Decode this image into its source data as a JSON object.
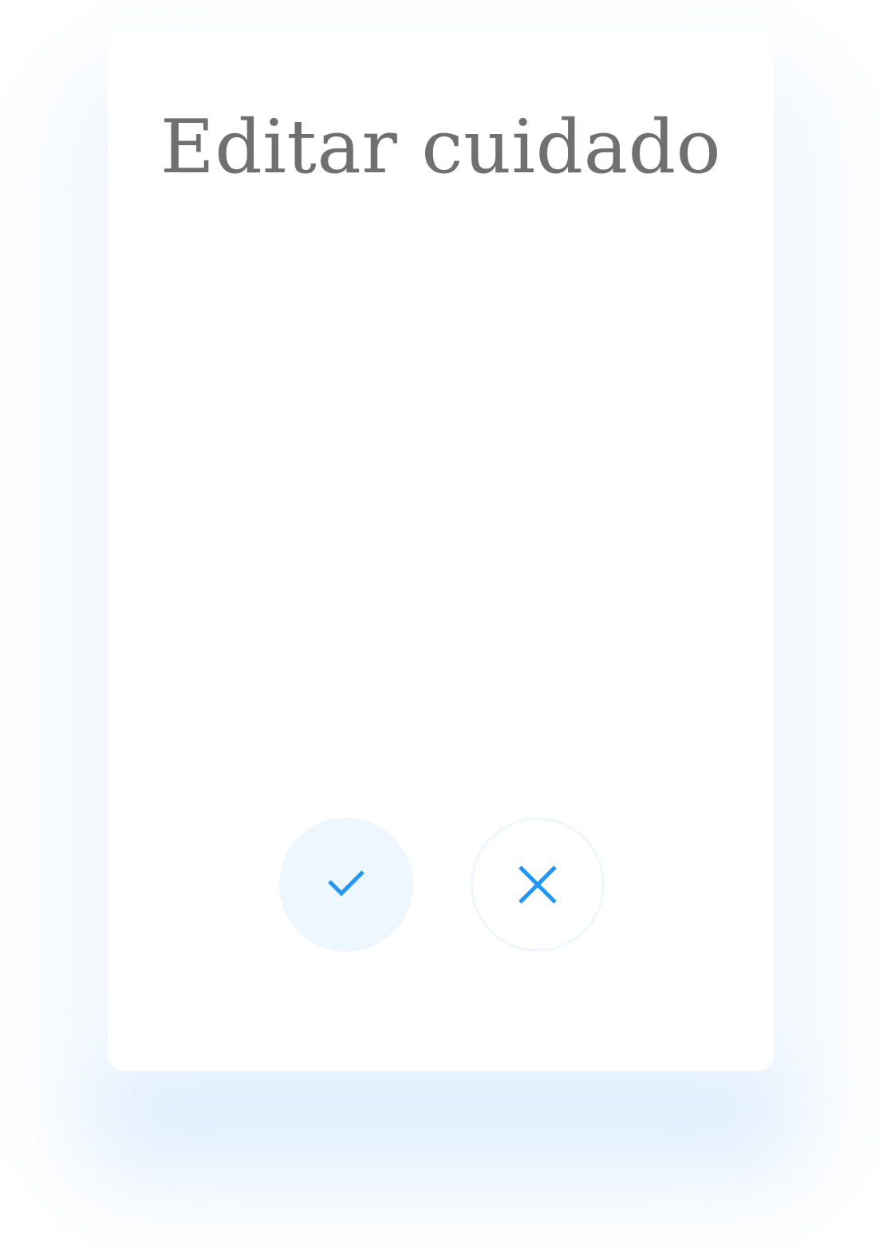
{
  "dialog": {
    "title": "Editar cuidado"
  },
  "actions": {
    "confirm_icon": "check-icon",
    "cancel_icon": "close-icon"
  },
  "colors": {
    "title_text": "#707070",
    "accent": "#2196f3",
    "button_fill": "#eef6fe",
    "background_glow": "#e6f2fd"
  }
}
